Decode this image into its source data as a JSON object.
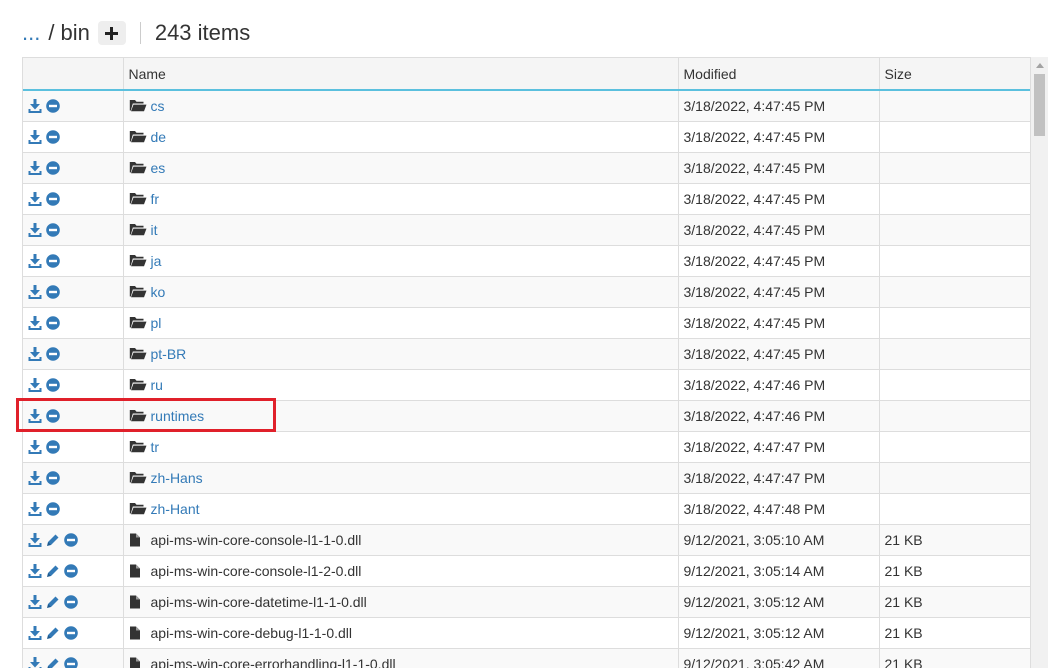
{
  "breadcrumb": {
    "ellipsis": "...",
    "separator": "/",
    "current": "bin",
    "add_label": "+"
  },
  "item_count": "243 items",
  "columns": {
    "name": "Name",
    "modified": "Modified",
    "size": "Size"
  },
  "colors": {
    "link": "#337ab7",
    "header_border": "#5bc0de",
    "highlight": "#e0202a"
  },
  "rows": [
    {
      "name": "cs",
      "modified": "3/18/2022, 4:47:45 PM",
      "size": ""
    },
    {
      "name": "de",
      "modified": "3/18/2022, 4:47:45 PM",
      "size": ""
    },
    {
      "name": "es",
      "modified": "3/18/2022, 4:47:45 PM",
      "size": ""
    },
    {
      "name": "fr",
      "modified": "3/18/2022, 4:47:45 PM",
      "size": ""
    },
    {
      "name": "it",
      "modified": "3/18/2022, 4:47:45 PM",
      "size": ""
    },
    {
      "name": "ja",
      "modified": "3/18/2022, 4:47:45 PM",
      "size": ""
    },
    {
      "name": "ko",
      "modified": "3/18/2022, 4:47:45 PM",
      "size": ""
    },
    {
      "name": "pl",
      "modified": "3/18/2022, 4:47:45 PM",
      "size": ""
    },
    {
      "name": "pt-BR",
      "modified": "3/18/2022, 4:47:45 PM",
      "size": ""
    },
    {
      "name": "ru",
      "modified": "3/18/2022, 4:47:46 PM",
      "size": ""
    },
    {
      "name": "runtimes",
      "modified": "3/18/2022, 4:47:46 PM",
      "size": ""
    },
    {
      "name": "tr",
      "modified": "3/18/2022, 4:47:47 PM",
      "size": ""
    },
    {
      "name": "zh-Hans",
      "modified": "3/18/2022, 4:47:47 PM",
      "size": ""
    },
    {
      "name": "zh-Hant",
      "modified": "3/18/2022, 4:47:48 PM",
      "size": ""
    },
    {
      "name": "api-ms-win-core-console-l1-1-0.dll",
      "modified": "9/12/2021, 3:05:10 AM",
      "size": "21 KB"
    },
    {
      "name": "api-ms-win-core-console-l1-2-0.dll",
      "modified": "9/12/2021, 3:05:14 AM",
      "size": "21 KB"
    },
    {
      "name": "api-ms-win-core-datetime-l1-1-0.dll",
      "modified": "9/12/2021, 3:05:12 AM",
      "size": "21 KB"
    },
    {
      "name": "api-ms-win-core-debug-l1-1-0.dll",
      "modified": "9/12/2021, 3:05:12 AM",
      "size": "21 KB"
    },
    {
      "name": "api-ms-win-core-errorhandling-l1-1-0.dll",
      "modified": "9/12/2021, 3:05:42 AM",
      "size": "21 KB"
    }
  ]
}
